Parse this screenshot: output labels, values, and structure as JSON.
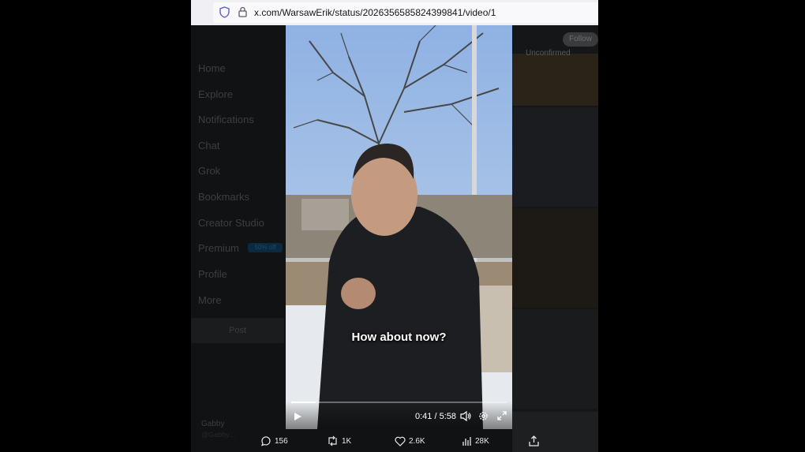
{
  "browser": {
    "url": "x.com/WarsawErik/status/2026356585824399841/video/1"
  },
  "sidebar": {
    "items": [
      {
        "label": "Home"
      },
      {
        "label": "Explore"
      },
      {
        "label": "Notifications"
      },
      {
        "label": "Chat"
      },
      {
        "label": "Grok"
      },
      {
        "label": "Bookmarks"
      },
      {
        "label": "Creator Studio"
      },
      {
        "label": "Premium"
      },
      {
        "label": "Profile"
      },
      {
        "label": "More"
      }
    ],
    "premium_badge": "50% off",
    "post_label": "Post",
    "account_name": "Gabby",
    "account_handle": "@Gabby..."
  },
  "right_panel": {
    "follow_label": "Follow",
    "title": "Unconfirmed"
  },
  "video": {
    "subtitle": "How about now?",
    "time_display": "0:41 / 5:58",
    "progress": 0.114
  },
  "actions": {
    "replies": "156",
    "reposts": "1K",
    "likes": "2.6K",
    "views": "28K"
  },
  "colors": {
    "accent": "#1d9bf0",
    "page_bg": "#000000"
  }
}
